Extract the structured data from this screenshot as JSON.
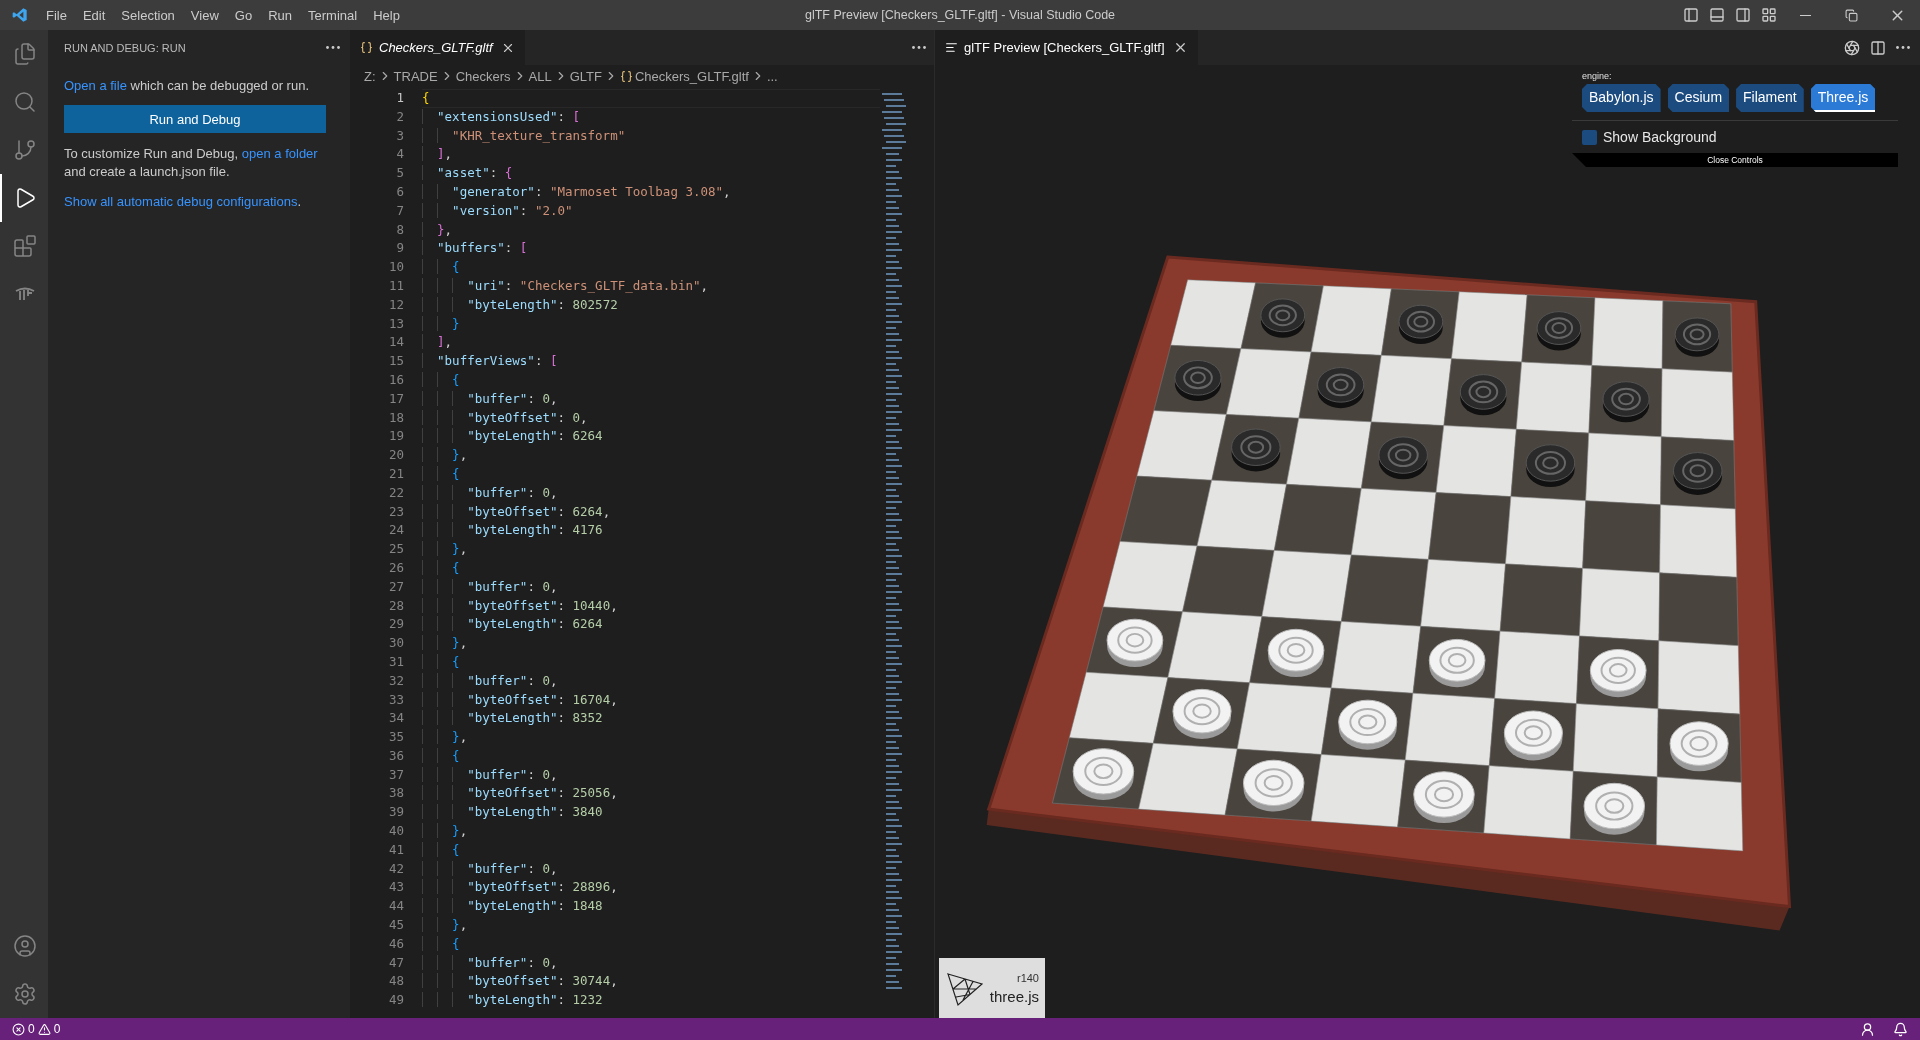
{
  "window": {
    "title": "glTF Preview [Checkers_GLTF.gltf] - Visual Studio Code"
  },
  "menu": [
    "File",
    "Edit",
    "Selection",
    "View",
    "Go",
    "Run",
    "Terminal",
    "Help"
  ],
  "activity_bar": [
    {
      "kind": "explorer",
      "selected": false
    },
    {
      "kind": "search",
      "selected": false
    },
    {
      "kind": "source-control",
      "selected": false
    },
    {
      "kind": "run-debug",
      "selected": true
    },
    {
      "kind": "extensions",
      "selected": false
    },
    {
      "kind": "custom",
      "selected": false
    }
  ],
  "activity_bar_bottom": [
    {
      "kind": "account"
    },
    {
      "kind": "settings"
    }
  ],
  "sidebar": {
    "title": "RUN AND DEBUG: RUN",
    "open_file_link": "Open a file",
    "open_file_text": " which can be debugged or run.",
    "button": "Run and Debug",
    "customize_text": "To customize Run and Debug, ",
    "open_folder_link": "open a folder",
    "customize_after": " and create a launch.json file.",
    "show_all_link": "Show all automatic debug configurations",
    "show_all_after": "."
  },
  "editor": {
    "tab": {
      "label": "Checkers_GLTF.gltf"
    },
    "breadcrumbs": [
      "Z:",
      "TRADE",
      "Checkers",
      "ALL",
      "GLTF",
      "Checkers_GLTF.gltf",
      "..."
    ],
    "lines": [
      {
        "number": "1",
        "text": "{",
        "current": true
      },
      {
        "number": "2",
        "text": "  \"extensionsUsed\": [",
        "current": false
      },
      {
        "number": "3",
        "text": "    \"KHR_texture_transform\"",
        "current": false
      },
      {
        "number": "4",
        "text": "  ],",
        "current": false
      },
      {
        "number": "5",
        "text": "  \"asset\": {",
        "current": false
      },
      {
        "number": "6",
        "text": "    \"generator\": \"Marmoset Toolbag 3.08\",",
        "current": false
      },
      {
        "number": "7",
        "text": "    \"version\": \"2.0\"",
        "current": false
      },
      {
        "number": "8",
        "text": "  },",
        "current": false
      },
      {
        "number": "9",
        "text": "  \"buffers\": [",
        "current": false
      },
      {
        "number": "10",
        "text": "    {",
        "current": false
      },
      {
        "number": "11",
        "text": "      \"uri\": \"Checkers_GLTF_data.bin\",",
        "current": false
      },
      {
        "number": "12",
        "text": "      \"byteLength\": 802572",
        "current": false
      },
      {
        "number": "13",
        "text": "    }",
        "current": false
      },
      {
        "number": "14",
        "text": "  ],",
        "current": false
      },
      {
        "number": "15",
        "text": "  \"bufferViews\": [",
        "current": false
      },
      {
        "number": "16",
        "text": "    {",
        "current": false
      },
      {
        "number": "17",
        "text": "      \"buffer\": 0,",
        "current": false
      },
      {
        "number": "18",
        "text": "      \"byteOffset\": 0,",
        "current": false
      },
      {
        "number": "19",
        "text": "      \"byteLength\": 6264",
        "current": false
      },
      {
        "number": "20",
        "text": "    },",
        "current": false
      },
      {
        "number": "21",
        "text": "    {",
        "current": false
      },
      {
        "number": "22",
        "text": "      \"buffer\": 0,",
        "current": false
      },
      {
        "number": "23",
        "text": "      \"byteOffset\": 6264,",
        "current": false
      },
      {
        "number": "24",
        "text": "      \"byteLength\": 4176",
        "current": false
      },
      {
        "number": "25",
        "text": "    },",
        "current": false
      },
      {
        "number": "26",
        "text": "    {",
        "current": false
      },
      {
        "number": "27",
        "text": "      \"buffer\": 0,",
        "current": false
      },
      {
        "number": "28",
        "text": "      \"byteOffset\": 10440,",
        "current": false
      },
      {
        "number": "29",
        "text": "      \"byteLength\": 6264",
        "current": false
      },
      {
        "number": "30",
        "text": "    },",
        "current": false
      },
      {
        "number": "31",
        "text": "    {",
        "current": false
      },
      {
        "number": "32",
        "text": "      \"buffer\": 0,",
        "current": false
      },
      {
        "number": "33",
        "text": "      \"byteOffset\": 16704,",
        "current": false
      },
      {
        "number": "34",
        "text": "      \"byteLength\": 8352",
        "current": false
      },
      {
        "number": "35",
        "text": "    },",
        "current": false
      },
      {
        "number": "36",
        "text": "    {",
        "current": false
      },
      {
        "number": "37",
        "text": "      \"buffer\": 0,",
        "current": false
      },
      {
        "number": "38",
        "text": "      \"byteOffset\": 25056,",
        "current": false
      },
      {
        "number": "39",
        "text": "      \"byteLength\": 3840",
        "current": false
      },
      {
        "number": "40",
        "text": "    },",
        "current": false
      },
      {
        "number": "41",
        "text": "    {",
        "current": false
      },
      {
        "number": "42",
        "text": "      \"buffer\": 0,",
        "current": false
      },
      {
        "number": "43",
        "text": "      \"byteOffset\": 28896,",
        "current": false
      },
      {
        "number": "44",
        "text": "      \"byteLength\": 1848",
        "current": false
      },
      {
        "number": "45",
        "text": "    },",
        "current": false
      },
      {
        "number": "46",
        "text": "    {",
        "current": false
      },
      {
        "number": "47",
        "text": "      \"buffer\": 0,",
        "current": false
      },
      {
        "number": "48",
        "text": "      \"byteOffset\": 30744,",
        "current": false
      },
      {
        "number": "49",
        "text": "      \"byteLength\": 1232",
        "current": false
      }
    ]
  },
  "preview": {
    "tab": {
      "label": "glTF Preview [Checkers_GLTF.gltf]"
    },
    "engine_label": "engine:",
    "engines": [
      {
        "label": "Babylon.js",
        "selected": false
      },
      {
        "label": "Cesium",
        "selected": false
      },
      {
        "label": "Filament",
        "selected": false
      },
      {
        "label": "Three.js",
        "selected": true
      }
    ],
    "show_background": {
      "label": "Show Background",
      "checked": false
    },
    "close_controls": "Close Controls",
    "badge": {
      "revision": "r140",
      "name": "three.js"
    }
  },
  "status_bar": {
    "errors": "0",
    "warnings": "0"
  }
}
